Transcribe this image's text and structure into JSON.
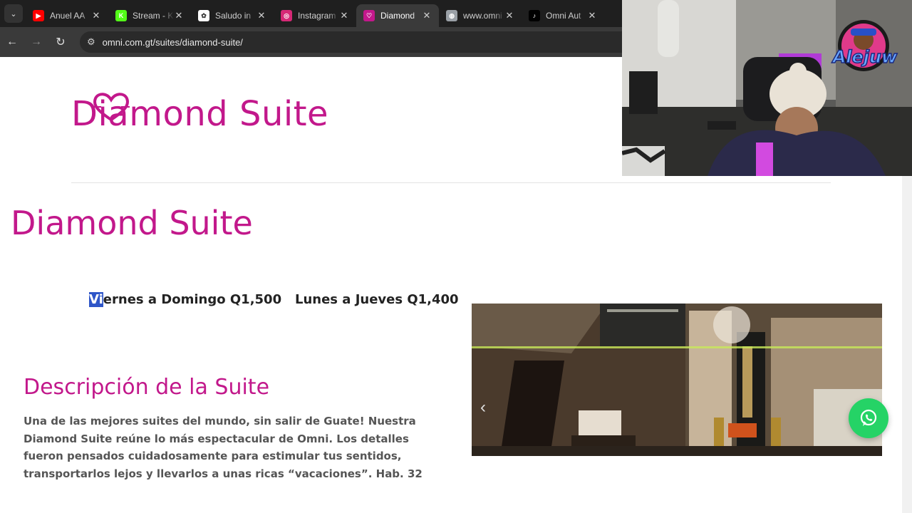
{
  "browser": {
    "tabs": [
      {
        "title": "Anuel AA",
        "fav_color": "#ff0000",
        "fav_glyph": "▶",
        "active": false
      },
      {
        "title": "Stream - K",
        "fav_color": "#53fc18",
        "fav_glyph": "K",
        "active": false
      },
      {
        "title": "Saludo in",
        "fav_color": "#ffffff",
        "fav_glyph": "✿",
        "active": false
      },
      {
        "title": "Instagram",
        "fav_color": "#d62976",
        "fav_glyph": "◎",
        "active": false
      },
      {
        "title": "Diamond",
        "fav_color": "#c2188b",
        "fav_glyph": "♡",
        "active": true
      },
      {
        "title": "www.omni",
        "fav_color": "#9aa0a6",
        "fav_glyph": "◍",
        "active": false
      },
      {
        "title": "Omni Aut",
        "fav_color": "#000000",
        "fav_glyph": "♪",
        "active": false
      }
    ],
    "url": "omni.com.gt/suites/diamond-suite/"
  },
  "page": {
    "logo_text": "Diamond Suite",
    "heading": "Diamond Suite",
    "price_weekend_selected": "Vi",
    "price_weekend_rest": "ernes a Domingo Q1,500",
    "price_weekday": "Lunes a Jueves Q1,400",
    "section_title": "Descripción de la Suite",
    "description": "Una de las mejores suites del mundo, sin salir de Guate! Nuestra Diamond Suite reúne lo más espectacular de Omni. Los detalles fueron pensados cuidadosamente para estimular tus sentidos, transportarlos lejos y llevarlos a unas ricas “vacaciones”. Hab. 32"
  },
  "overlay": {
    "streamer_logo": "Alejuw"
  },
  "colors": {
    "brand_magenta": "#c2188b",
    "whatsapp_green": "#25d366"
  }
}
